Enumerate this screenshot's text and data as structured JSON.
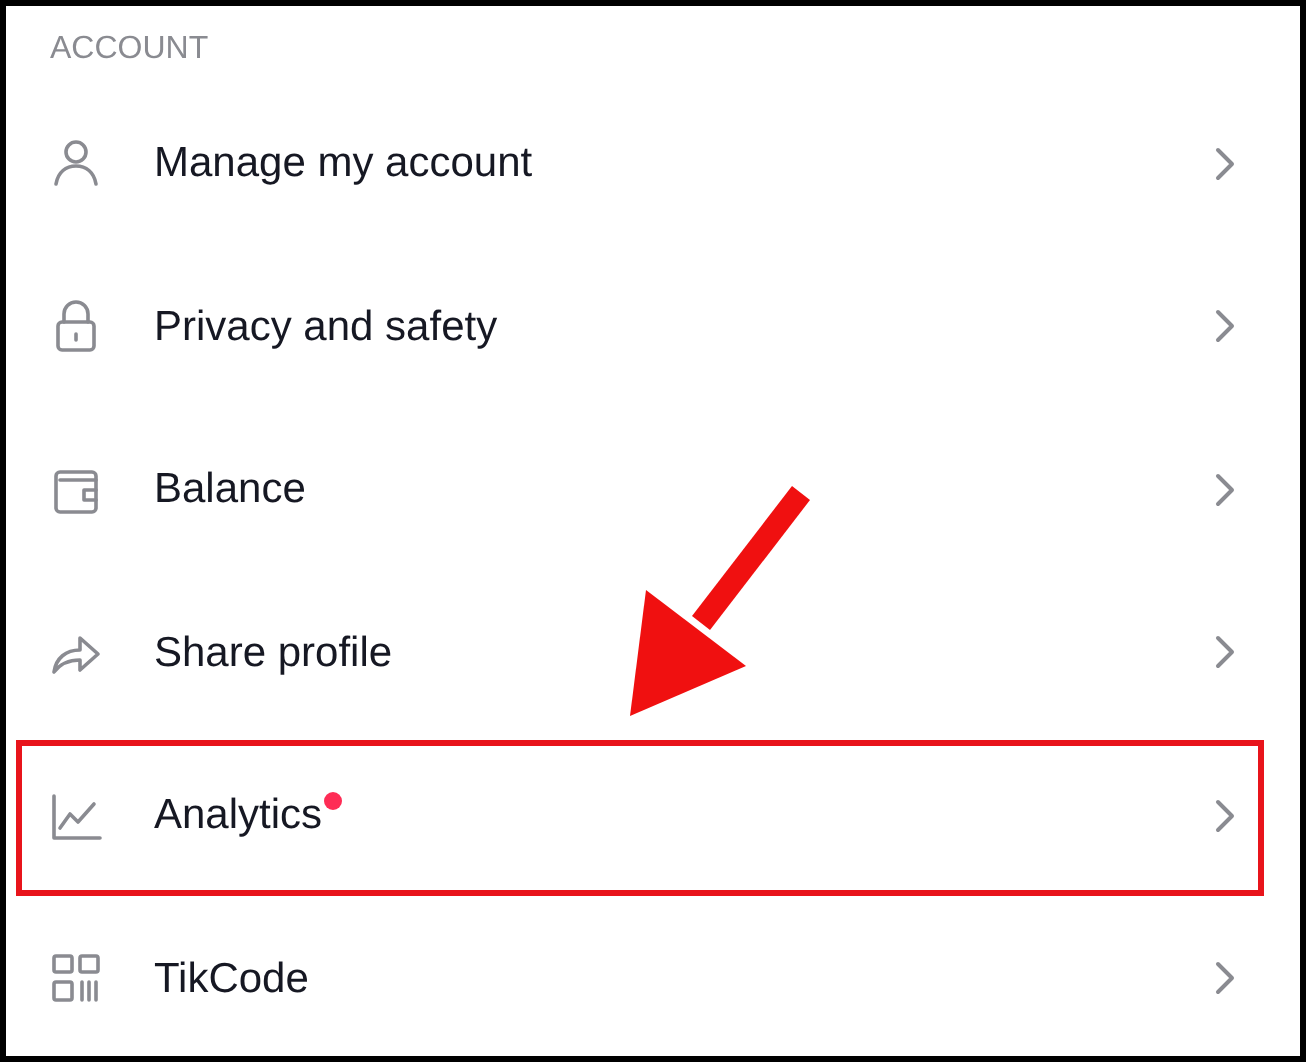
{
  "section": {
    "title": "ACCOUNT"
  },
  "items": [
    {
      "label": "Manage my account",
      "dot": false,
      "highlighted": false
    },
    {
      "label": "Privacy and safety",
      "dot": false,
      "highlighted": false
    },
    {
      "label": "Balance",
      "dot": false,
      "highlighted": false
    },
    {
      "label": "Share profile",
      "dot": false,
      "highlighted": false
    },
    {
      "label": "Analytics",
      "dot": true,
      "highlighted": true
    },
    {
      "label": "TikCode",
      "dot": false,
      "highlighted": false
    }
  ]
}
